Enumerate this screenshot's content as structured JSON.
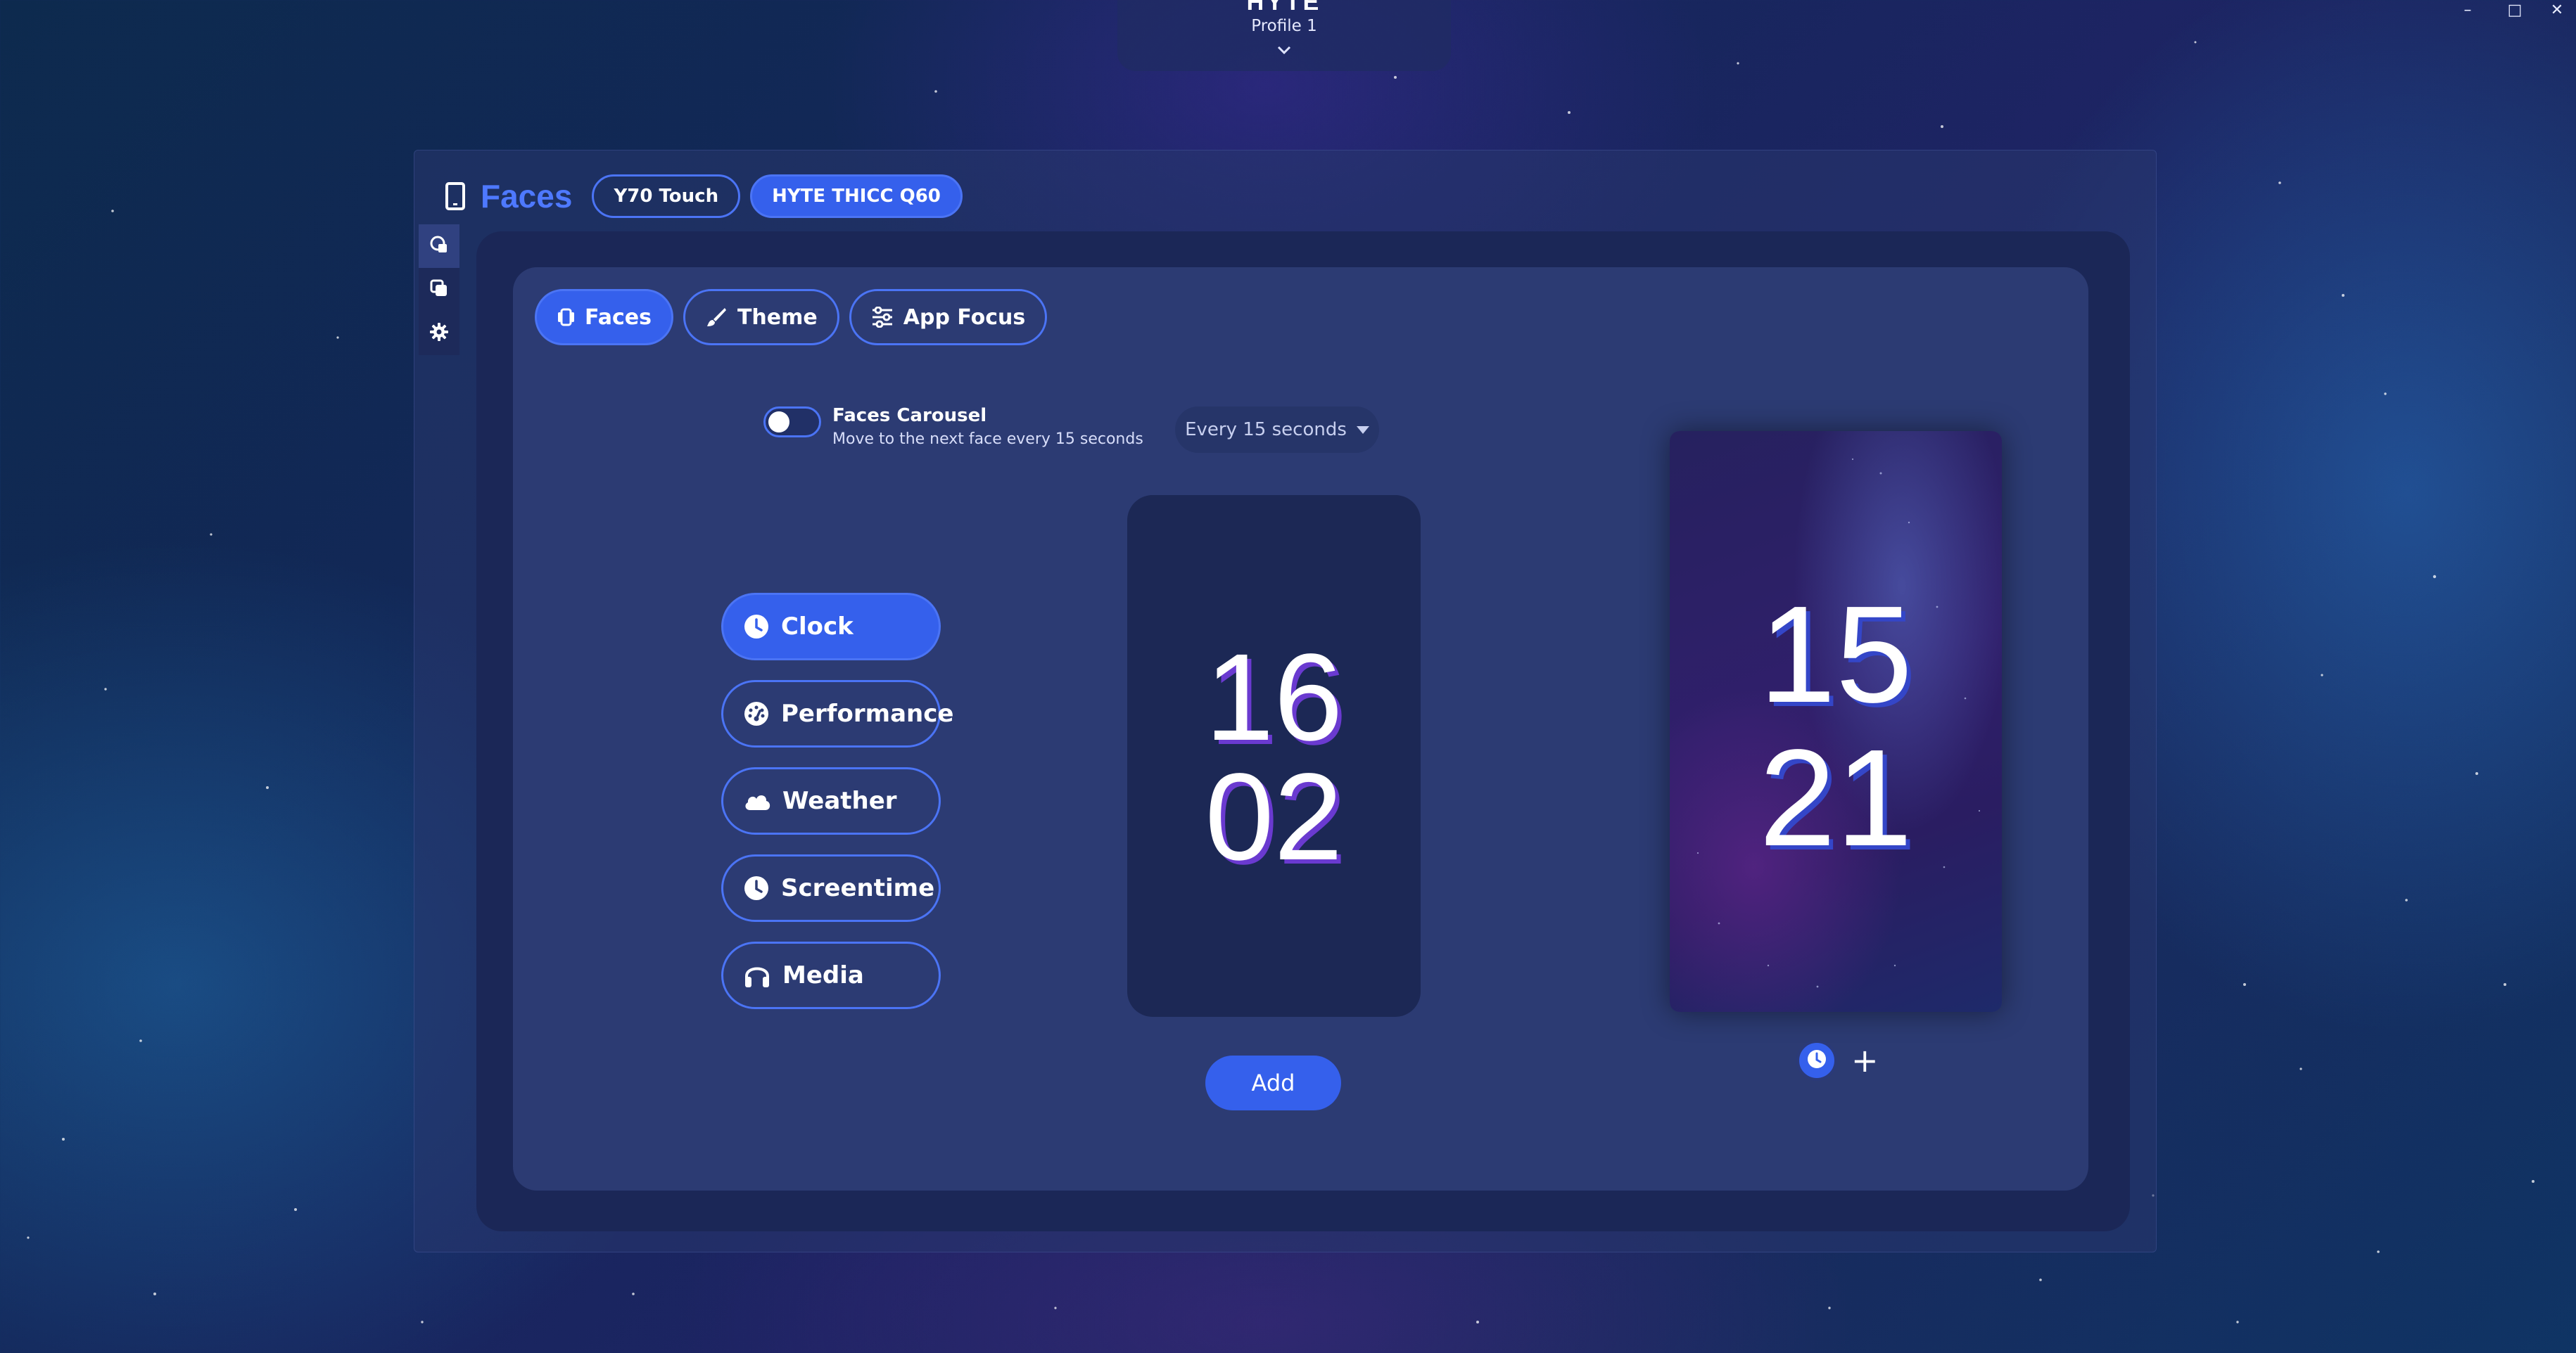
{
  "titlebar": {
    "brand": "HYTE",
    "profile": "Profile 1",
    "minimize": "–",
    "maximize": "□",
    "close": "✕"
  },
  "header": {
    "title": "Faces",
    "devices": [
      "Y70 Touch",
      "HYTE THICC Q60"
    ],
    "active_device": "HYTE THICC Q60"
  },
  "side_nav": {
    "items": [
      "faces-icon",
      "layers-icon",
      "gear-icon"
    ]
  },
  "sub_tabs": {
    "faces": "Faces",
    "theme": "Theme",
    "app_focus": "App Focus",
    "active": "Faces"
  },
  "carousel": {
    "title": "Faces Carousel",
    "subtitle": "Move to the next face every 15 seconds",
    "enabled": false,
    "interval": "Every 15 seconds"
  },
  "face_list": {
    "clock": "Clock",
    "performance": "Performance",
    "weather": "Weather",
    "screentime": "Screentime",
    "media": "Media",
    "active": "Clock"
  },
  "preview": {
    "hour": "16",
    "minute": "02",
    "add_label": "Add"
  },
  "device_screen": {
    "hour": "15",
    "minute": "21",
    "add_symbol": "+"
  },
  "colors": {
    "accent": "#3560EC",
    "title_blue": "#4E79FF",
    "panel": "#2C3B73",
    "panel_dark": "#1B2757"
  }
}
